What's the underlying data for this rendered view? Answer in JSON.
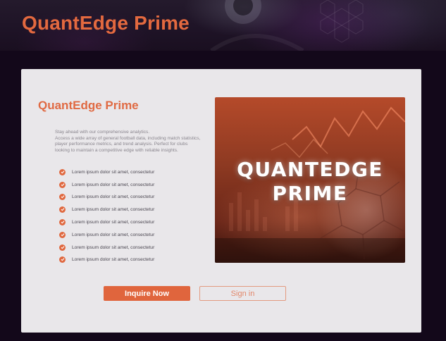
{
  "header": {
    "title": "QuantEdge Prime"
  },
  "card": {
    "title": "QuantEdge Prime",
    "description": [
      "Stay ahead with our comprehensive analytics.",
      "Access a wide array of general football data, including match statistics,",
      "player performance metrics, and trend analysis. Perfect for clubs",
      "looking to maintain a competitive edge with reliable insights."
    ],
    "features": [
      "Lorem ipsum dolor sit amet, consectetur",
      "Lorem ipsum dolor sit amet, consectetur",
      "Lorem ipsum dolor sit amet, consectetur",
      "Lorem ipsum dolor sit amet, consectetur",
      "Lorem ipsum dolor sit amet, consectetur",
      "Lorem ipsum dolor sit amet, consectetur",
      "Lorem ipsum dolor sit amet, consectetur",
      "Lorem ipsum dolor sit amet, consectetur"
    ],
    "promo_lines": [
      "QUANTEDGE",
      "PRIME"
    ],
    "buttons": {
      "primary": "Inquire Now",
      "secondary": "Sign in"
    }
  },
  "icons": {
    "feature": "check-circle-icon"
  },
  "colors": {
    "accent": "#e0653d",
    "background": "#13081a",
    "card": "#e9e7ea"
  }
}
